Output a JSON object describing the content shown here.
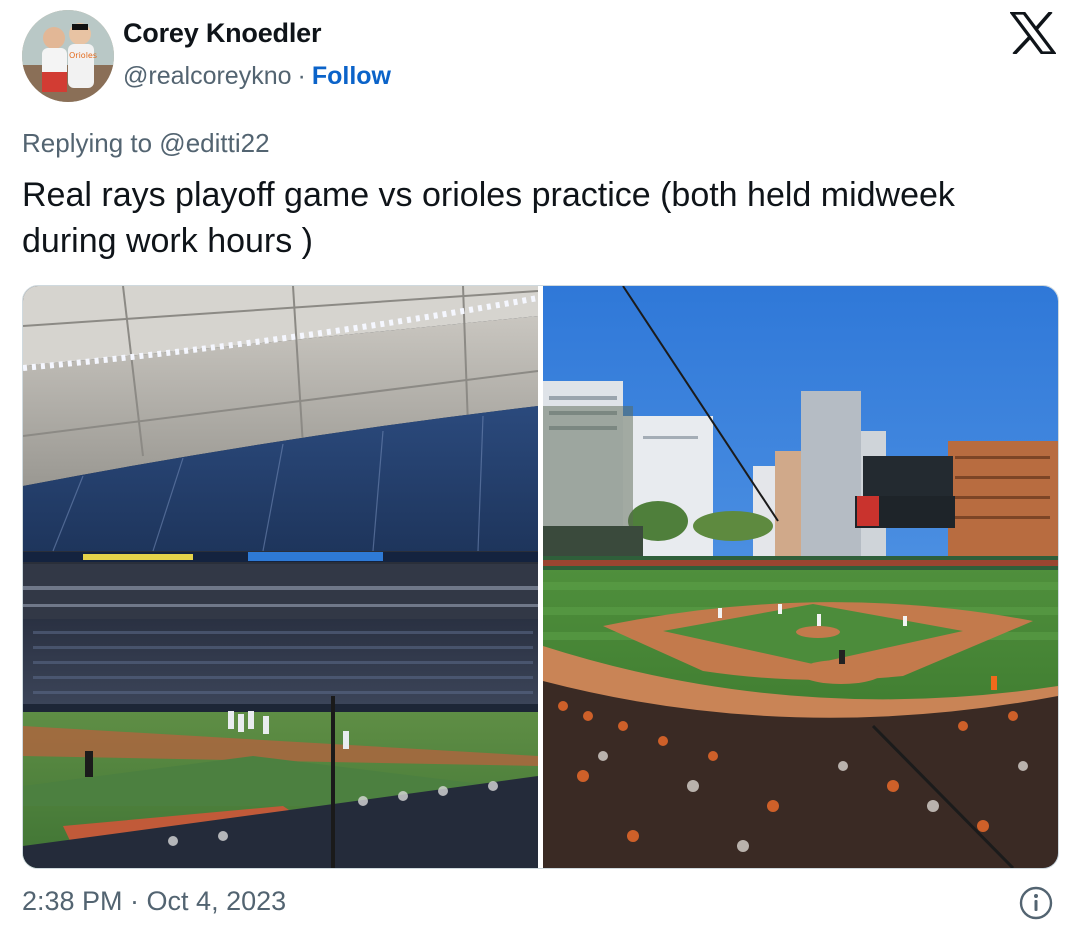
{
  "author": {
    "name": "Corey Knoedler",
    "handle": "@realcoreykno",
    "separator": "·",
    "follow_label": "Follow",
    "avatar_icon": "profile-photo"
  },
  "reply_context": "Replying to @editti22",
  "tweet_text": "Real rays playoff game vs orioles practice (both held midweek during work hours )",
  "media": [
    {
      "description_icon": "photo",
      "scene": "indoor-dome-stadium"
    },
    {
      "description_icon": "photo",
      "scene": "outdoor-ballpark"
    }
  ],
  "footer": {
    "timestamp": "2:38 PM · Oct 4, 2023",
    "info_icon": "info-icon"
  },
  "colors": {
    "text_primary": "#0f1419",
    "text_secondary": "#536471",
    "link": "#0b63c9",
    "border": "#cfd9de"
  }
}
